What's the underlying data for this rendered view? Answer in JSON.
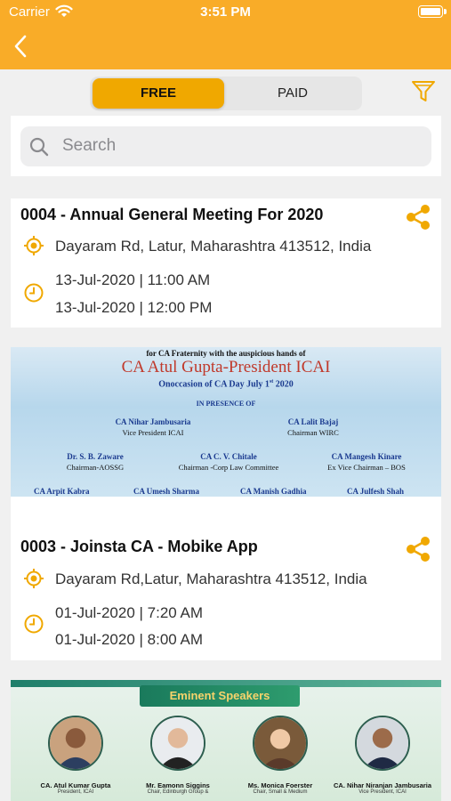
{
  "status_bar": {
    "carrier": "Carrier",
    "time": "3:51 PM"
  },
  "tabs": {
    "free": "FREE",
    "paid": "PAID",
    "selected": "FREE"
  },
  "search": {
    "placeholder": "Search"
  },
  "colors": {
    "accent": "#f9ac28",
    "tab_selected": "#f0a800",
    "icon": "#f0a800",
    "background": "#f0f0f0"
  },
  "icons": {
    "back": "chevron-left-icon",
    "filter": "funnel-icon",
    "search": "magnifier-icon",
    "share": "share-icon",
    "location": "location-target-icon",
    "time": "clock-icon"
  },
  "events": [
    {
      "title": "0004 - Annual General Meeting For 2020",
      "location": "Dayaram Rd, Latur, Maharashtra 413512, India",
      "start": "13-Jul-2020 | 11:00 AM",
      "end": "13-Jul-2020 | 12:00 PM"
    },
    {
      "title": "0003 - Joinsta CA - Mobike App",
      "location": "Dayaram Rd,Latur, Maharashtra 413512, India",
      "start": "01-Jul-2020 | 7:20 AM",
      "end": "01-Jul-2020 | 8:00 AM"
    }
  ],
  "banner1": {
    "line1": "for CA Fraternity with the auspicious hands of",
    "title": "CA Atul Gupta-President ICAI",
    "occasion": "Onoccasion of CA Day July 1",
    "occasion_sup": "st",
    "occasion_year": "2020",
    "presence": "IN PRESENCE OF",
    "people": [
      {
        "name": "CA Nihar Jambusaria",
        "role": "Vice President ICAI"
      },
      {
        "name": "CA Lalit Bajaj",
        "role": "Chairman WIRC"
      },
      {
        "name": "Dr. S. B. Zaware",
        "role": "Chairman-AOSSG"
      },
      {
        "name": "CA C. V. Chitale",
        "role": "Chairman -Corp Law  Committee"
      },
      {
        "name": "CA Mangesh Kinare",
        "role": "Ex Vice Chairman – BOS"
      }
    ],
    "bottom_names": [
      "CA Arpit Kabra",
      "CA Umesh Sharma",
      "CA Manish Gadhia",
      "CA Julfesh Shah"
    ]
  },
  "banner2": {
    "heading": "Eminent Speakers",
    "speakers": [
      {
        "name": "CA. Atul Kumar Gupta",
        "role": "President, ICAI"
      },
      {
        "name": "Mr. Eamonn Siggins",
        "role": "Chair, Edinburgh Group &"
      },
      {
        "name": "Ms. Monica Foerster",
        "role": "Chair, Small & Medium"
      },
      {
        "name": "CA. Nihar Niranjan Jambusaria",
        "role": "Vice President, ICAI"
      }
    ]
  }
}
